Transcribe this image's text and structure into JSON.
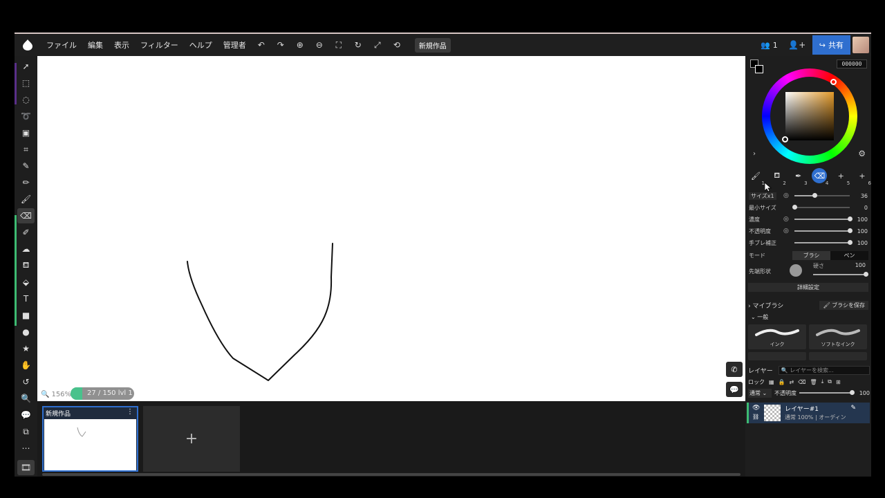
{
  "menu": [
    "ファイル",
    "編集",
    "表示",
    "フィルター",
    "ヘルプ",
    "管理者"
  ],
  "doc_title": "新規作品",
  "users_count": "1",
  "share_label": "共有",
  "hex_value": "000000",
  "presets": [
    "1",
    "2",
    "3",
    "4",
    "5",
    "6"
  ],
  "brush": {
    "size_label": "サイズx1",
    "size_value": "36",
    "size_fraction": 0.36,
    "min_size_label": "最小サイズ",
    "min_size_value": "0",
    "density_label": "濃度",
    "density_value": "100",
    "opacity_label": "不透明度",
    "opacity_value": "100",
    "stabilizer_label": "手ブレ補正",
    "stabilizer_value": "100",
    "mode_label": "モード",
    "mode_brush": "ブラシ",
    "mode_pen": "ペン",
    "tip_label": "先端形状",
    "hardness_label": "硬さ",
    "hardness_value": "100",
    "detail_label": "詳細設定"
  },
  "my_brush_label": "マイブラシ",
  "save_brush_label": "ブラシを保存",
  "general_label": "一般",
  "brush_cards": [
    "インク",
    "ソフトなインク"
  ],
  "layers": {
    "header": "レイヤー",
    "search_placeholder": "レイヤーを検索...",
    "lock_label": "ロック",
    "blend_mode": "通常",
    "opacity_label": "不透明度",
    "opacity_value": "100",
    "item_name": "レイヤー#1",
    "item_meta": "通常 100% | オーディン"
  },
  "canvas": {
    "zoom": "156%",
    "progress_text": "27 / 150",
    "level_text": "lvl 1",
    "progress_fraction": 0.18
  },
  "strip": {
    "card_title": "新規作品",
    "add_label": "+"
  },
  "colors": {
    "accent_blue": "#2f6fcf",
    "accent_green": "#3dbb72",
    "fg_color": "#000000"
  }
}
